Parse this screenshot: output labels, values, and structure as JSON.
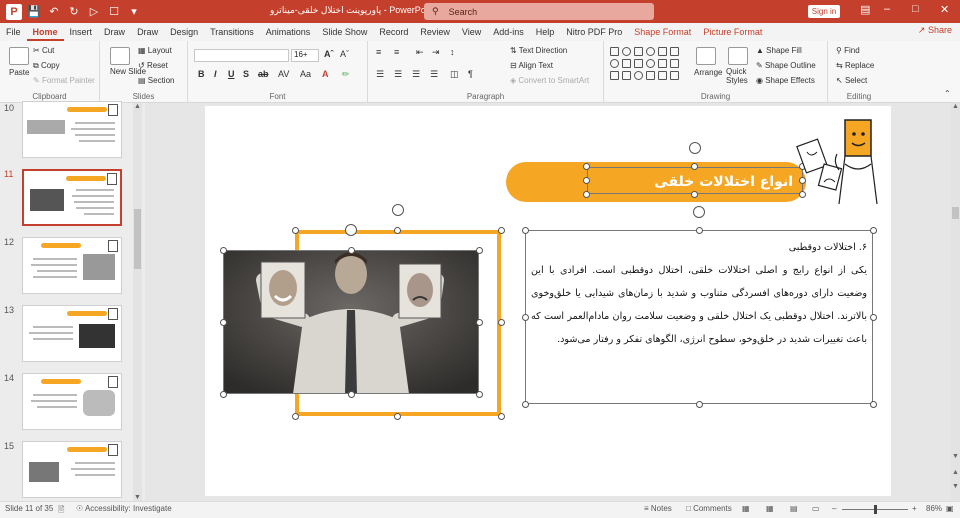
{
  "app": {
    "title": "پاورپوینت اختلال خلقی-میناترو  -  PowerPoint",
    "search_placeholder": "Search",
    "signin": "Sign in",
    "share": "Share",
    "accent": "#c4402c"
  },
  "menu": {
    "tabs": [
      "File",
      "Home",
      "Insert",
      "Draw",
      "Draw",
      "Design",
      "Transitions",
      "Animations",
      "Slide Show",
      "Record",
      "Review",
      "View",
      "Add-ins",
      "Help",
      "Nitro PDF Pro"
    ],
    "active_index": 1,
    "contextual": [
      "Shape Format",
      "Picture Format"
    ]
  },
  "ribbon": {
    "clipboard": {
      "paste": "Paste",
      "cut": "Cut",
      "copy": "Copy",
      "painter": "Format Painter",
      "label": "Clipboard"
    },
    "slides": {
      "new_slide": "New Slide",
      "layout": "Layout",
      "reset": "Reset",
      "section": "Section",
      "label": "Slides"
    },
    "font": {
      "family": "",
      "size": "16+",
      "label": "Font"
    },
    "paragraph": {
      "text_direction": "Text Direction",
      "align_text": "Align Text",
      "smartart": "Convert to SmartArt",
      "label": "Paragraph"
    },
    "drawing": {
      "arrange": "Arrange",
      "quick_styles": "Quick Styles",
      "shape_fill": "Shape Fill",
      "shape_outline": "Shape Outline",
      "shape_effects": "Shape Effects",
      "label": "Drawing"
    },
    "editing": {
      "find": "Find",
      "replace": "Replace",
      "select": "Select",
      "label": "Editing"
    }
  },
  "thumbnails": [
    {
      "num": "10"
    },
    {
      "num": "11"
    },
    {
      "num": "12"
    },
    {
      "num": "13"
    },
    {
      "num": "14"
    },
    {
      "num": "15"
    }
  ],
  "current_slide_index": 1,
  "slide": {
    "title": "انواع اختلالات خلقی",
    "heading": "۶. اختلالات دوقطبی",
    "body": "یکی از انواع رایج و اصلی اختلالات خلقی، اختلال دوقطبی است. افرادی با این وضعیت دارای دوره‌های افسردگی متناوب و شدید با زمان‌های شیدایی یا خلق‌وخوی بالاترند. اختلال دوقطبی یک اختلال خلقی و وضعیت سلامت روان مادام‌العمر است که باعث تغییرات شدید در خلق‌وخو، سطوح انرژی، الگوهای تفکر و رفتار می‌شود.",
    "bar_color": "#f5a623"
  },
  "status": {
    "slide_of": "Slide 11 of 35",
    "accessibility": "Accessibility: Investigate",
    "notes": "Notes",
    "comments": "Comments",
    "zoom": "86%"
  }
}
